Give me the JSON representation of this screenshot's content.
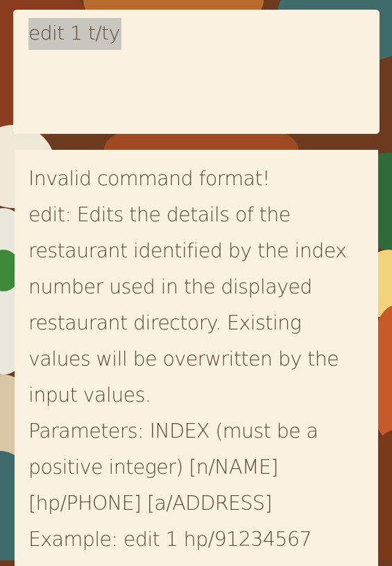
{
  "command": {
    "input_value": "edit 1 t/ty"
  },
  "result": {
    "lines": [
      "Invalid command format!",
      "edit: Edits the details of the",
      "restaurant identified by the index",
      "number used in the displayed",
      "restaurant directory. Existing",
      "values will be overwritten by the",
      "input values.",
      "Parameters: INDEX (must be a",
      "positive integer) [n/NAME]",
      "[hp/PHONE] [a/ADDRESS]",
      "Example: edit 1 hp/91234567"
    ]
  },
  "colors": {
    "panel": "#faf1e1",
    "text": "#5a4a3c",
    "selection": "#c9c5bf"
  }
}
